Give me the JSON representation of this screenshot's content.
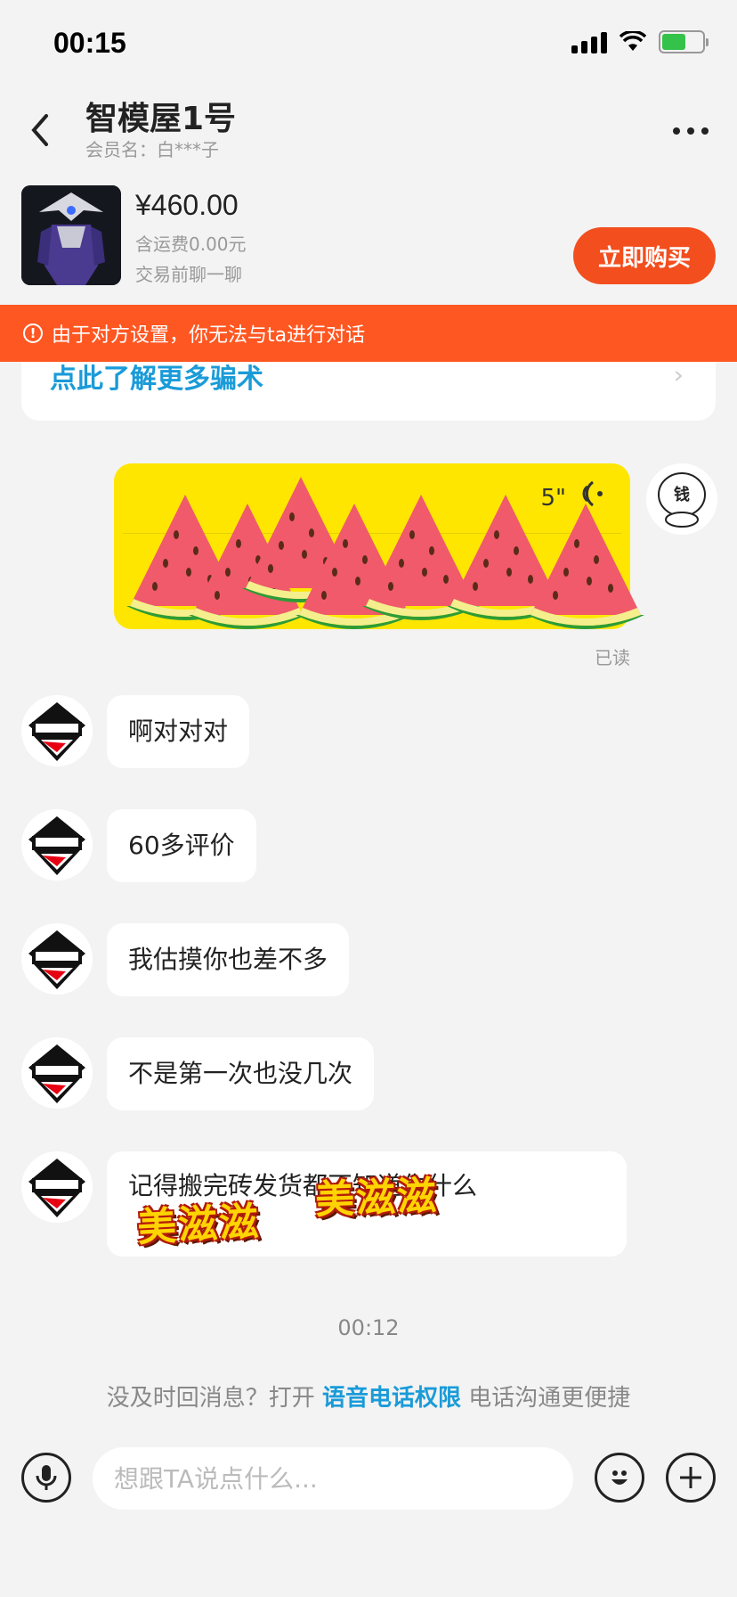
{
  "status_bar": {
    "time": "00:15"
  },
  "header": {
    "title": "智模屋1号",
    "member_label": "会员名：白***子"
  },
  "product": {
    "price": "¥460.00",
    "shipping": "含运费0.00元",
    "hint": "交易前聊一聊",
    "buy_label": "立即购买"
  },
  "notice": {
    "icon": "alert-icon",
    "text": "由于对方设置，你无法与ta进行对话"
  },
  "scam_card": {
    "link_text": "点此了解更多骗术"
  },
  "voice_message": {
    "duration": "5\"",
    "read_status": "已读",
    "sender_avatar_text": "钱"
  },
  "messages": [
    {
      "text": "啊对对对"
    },
    {
      "text": "60多评价"
    },
    {
      "text": "我估摸你也差不多"
    },
    {
      "text": "不是第一次也没几次"
    },
    {
      "text": "记得搬完砖发货都不知道你什么"
    }
  ],
  "stickers": [
    "美滋滋",
    "美滋滋"
  ],
  "timestamp": "00:12",
  "callout": {
    "prefix": "没及时回消息？打开",
    "link": "语音电话权限",
    "suffix": "电话沟通更便捷"
  },
  "input": {
    "placeholder": "想跟TA说点什么..."
  },
  "colors": {
    "accent": "#f24e1e",
    "notice": "#ff5722",
    "link": "#1a9bd8",
    "voice": "#ffe600"
  }
}
